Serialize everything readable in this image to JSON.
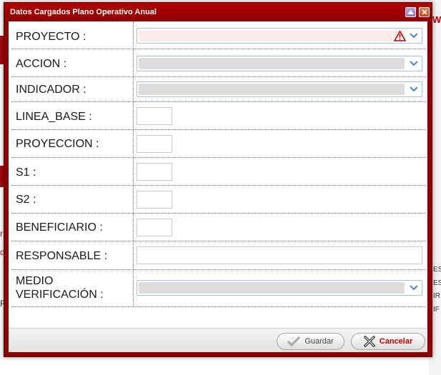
{
  "dialog": {
    "title": "Datos Cargados Plano Operativo Anual"
  },
  "form": {
    "proyecto_label": "PROYECTO :",
    "accion_label": "ACCION :",
    "indicador_label": "INDICADOR :",
    "linea_base_label": "LINEA_BASE :",
    "proyeccion_label": "PROYECCION :",
    "s1_label": "S1 :",
    "s2_label": "S2 :",
    "beneficiario_label": "BENEFICIARIO :",
    "responsable_label": "RESPONSABLE :",
    "medio_label_1": "MEDIO",
    "medio_label_2": "VERIFICACIÓN :",
    "proyecto_value": "",
    "accion_value": "",
    "indicador_value": "",
    "linea_base_value": "",
    "proyeccion_value": "",
    "s1_value": "",
    "s2_value": "",
    "beneficiario_value": "",
    "responsable_value": "",
    "medio_value": ""
  },
  "buttons": {
    "save_label": "Guardar",
    "cancel_label": "Cancelar"
  },
  "background": {
    "header_letter": "W",
    "left_frag_1": "r",
    "left_frag_2": "di",
    "left_frag_3": "R",
    "right_frag_1": "ES",
    "right_frag_2": "ES",
    "right_frag_3": "IR",
    "right_frag_4": "IF"
  },
  "colors": {
    "brand_red": "#8e0000",
    "cancel_text": "#c60000",
    "field_border": "#9ec3e6",
    "invalid_fill": "#fbeaea"
  },
  "icons": {
    "minimize": "triangle-up-icon",
    "close": "close-x-icon",
    "dropdown": "chevron-down-icon",
    "warning": "warning-triangle-icon",
    "save": "checkmark-icon",
    "cancel": "x-mark-icon"
  }
}
